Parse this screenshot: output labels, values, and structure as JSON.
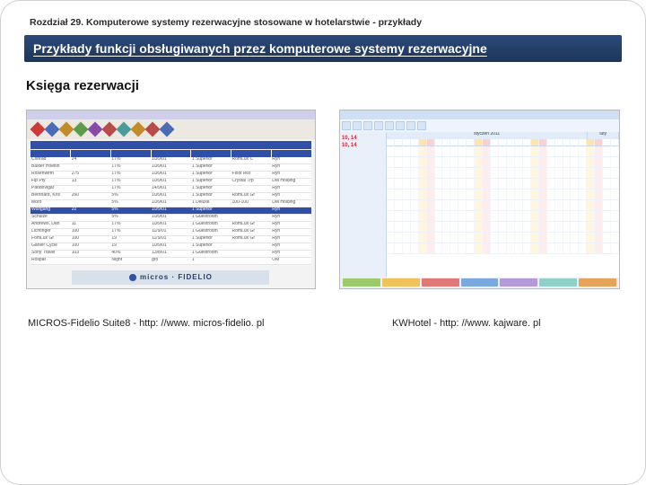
{
  "chapter": "Rozdział 29. Komputerowe systemy rezerwacyjne stosowane w hotelarstwie - przykłady",
  "title": "Przykłady funkcji obsługiwanych przez komputerowe systemy rezerwacyjne",
  "subtitle": "Księga rezerwacji",
  "captions": {
    "left": "MICROS-Fidelio Suite8 - http: //www. micros-fidelio. pl",
    "right": "KWHotel - http: //www. kajware. pl"
  },
  "fidelio": {
    "logo_text": "micros · FIDELIO",
    "rows": [
      [
        "Conrad",
        "24",
        "17%",
        "10/9/01",
        "1 Superior",
        "RomLux C",
        "Ryn"
      ],
      [
        "Baxter Hoeflin",
        "",
        "17%",
        "10/9/01",
        "1 Superior",
        "",
        "Ryn"
      ],
      [
        "Rosenwirth",
        "275",
        "17%",
        "10/9/01",
        "1 Superior",
        "FloorTest",
        "Ryn"
      ],
      [
        "Fip Pty",
        "13",
        "17%",
        "10/9/01",
        "1 Superior",
        "Crystal Trp",
        "DM Holding"
      ],
      [
        "Pandovigar",
        "",
        "17%",
        "14/9/01",
        "1 Superior",
        "",
        "Ryn"
      ],
      [
        "Bernhard, Kris",
        "260",
        "5%",
        "10/9/01",
        "1 Superior",
        "RomLux Gr",
        "Ryn"
      ],
      [
        "Moro",
        "",
        "5%",
        "10/9/01",
        "1 Deluxe",
        "100-100",
        "DM Holding"
      ],
      [
        "Wolfgang",
        "22",
        "5%",
        "10/9/01",
        "1 Superior",
        "",
        "Ryn"
      ],
      [
        "Schulze",
        "",
        "5%",
        "10/9/01",
        "1 Guestroom",
        "",
        "Ryn"
      ],
      [
        "Andrews, Dan",
        "11",
        "17%",
        "10/9/01",
        "1 Guestroom",
        "RomLux Gr",
        "Ryn"
      ],
      [
        "Lichtinger",
        "100",
        "17%",
        "11/9/01",
        "1 Guestroom",
        "RomLux Gr",
        "Ryn"
      ],
      [
        "FomLux Gr",
        "100",
        "19",
        "11/9/01",
        "1 Superior",
        "RomLux Gr",
        "Ryn"
      ],
      [
        "Garlier Cycle",
        "100",
        "19",
        "10/9/01",
        "1 Superior",
        "",
        "Ryn"
      ],
      [
        "Sony Travel",
        "103",
        "40%",
        "13/8/01",
        "1 Guestroom",
        "",
        "Ryn"
      ],
      [
        "Rospar",
        "",
        "Night",
        "gro",
        "1",
        "",
        "OM"
      ]
    ],
    "selected_row_index": 7
  },
  "kwhotel": {
    "side_labels": [
      "10, 14",
      "10, 14"
    ],
    "months": [
      "styczeń 2011",
      "luty"
    ],
    "weekend_cols_sat": [
      4,
      11,
      18,
      25
    ],
    "weekend_cols_sun": [
      5,
      12,
      19,
      26
    ],
    "num_day_cols": 29,
    "num_rows": 10
  }
}
